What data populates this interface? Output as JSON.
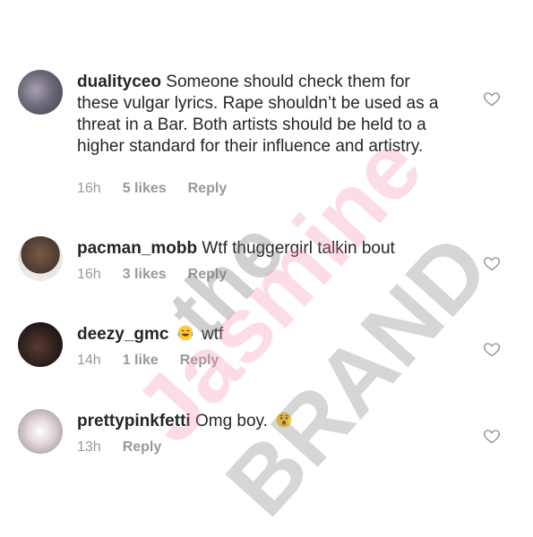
{
  "comments": [
    {
      "username": "dualityceo",
      "text": "Someone should check them for these vulgar lyrics. Rape shouldn’t be used as a threat in a Bar. Both artists should be held to a higher standard for their influence and artistry.",
      "time": "16h",
      "likes": "5 likes",
      "reply": "Reply",
      "avatar_color": "#6e6a7a"
    },
    {
      "username": "pacman_mobb",
      "text": "Wtf thuggergirl talkin bout",
      "time": "16h",
      "likes": "3 likes",
      "reply": "Reply",
      "avatar_color": "#4a3a30"
    },
    {
      "username": "deezy_gmc",
      "text_before_emoji": "",
      "emoji": "face-with-tears-of-joy",
      "text": "wtf",
      "time": "14h",
      "likes": "1 like",
      "reply": "Reply",
      "avatar_color": "#2b1e1c"
    },
    {
      "username": "prettypinkfetti",
      "text": "Omg boy.",
      "emoji": "hushed-face",
      "time": "13h",
      "likes": "",
      "reply": "Reply",
      "avatar_color": "#d8c8d0"
    }
  ],
  "watermark": {
    "line1": "the",
    "line2": "Jasmine",
    "line3": "BRAND"
  },
  "colors": {
    "text": "#262626",
    "meta": "#999999",
    "watermark_pink": "#f58cb4",
    "watermark_gray": "#787878"
  }
}
